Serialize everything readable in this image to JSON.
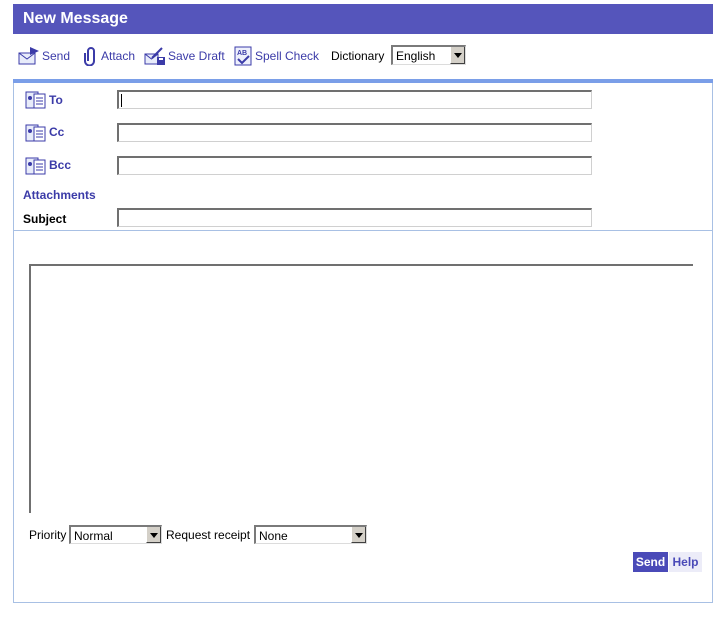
{
  "window": {
    "title": "New Message"
  },
  "toolbar": {
    "send_label": "Send",
    "attach_label": "Attach",
    "save_draft_label": "Save Draft",
    "spell_check_label": "Spell Check",
    "dictionary_label": "Dictionary",
    "dictionary_value": "English"
  },
  "fields": {
    "to_label": "To",
    "to_value": "",
    "cc_label": "Cc",
    "cc_value": "",
    "bcc_label": "Bcc",
    "bcc_value": "",
    "attachments_label": "Attachments",
    "subject_label": "Subject",
    "subject_value": ""
  },
  "body": {
    "value": ""
  },
  "options": {
    "priority_label": "Priority",
    "priority_value": "Normal",
    "receipt_label": "Request receipt",
    "receipt_value": "None"
  },
  "actions": {
    "send_label": "Send",
    "help_label": "Help"
  },
  "colors": {
    "title_bar": "#5555bb",
    "link": "#3b3ba8",
    "panel_border": "#a8c0e4",
    "send_button": "#4a4ab8"
  }
}
